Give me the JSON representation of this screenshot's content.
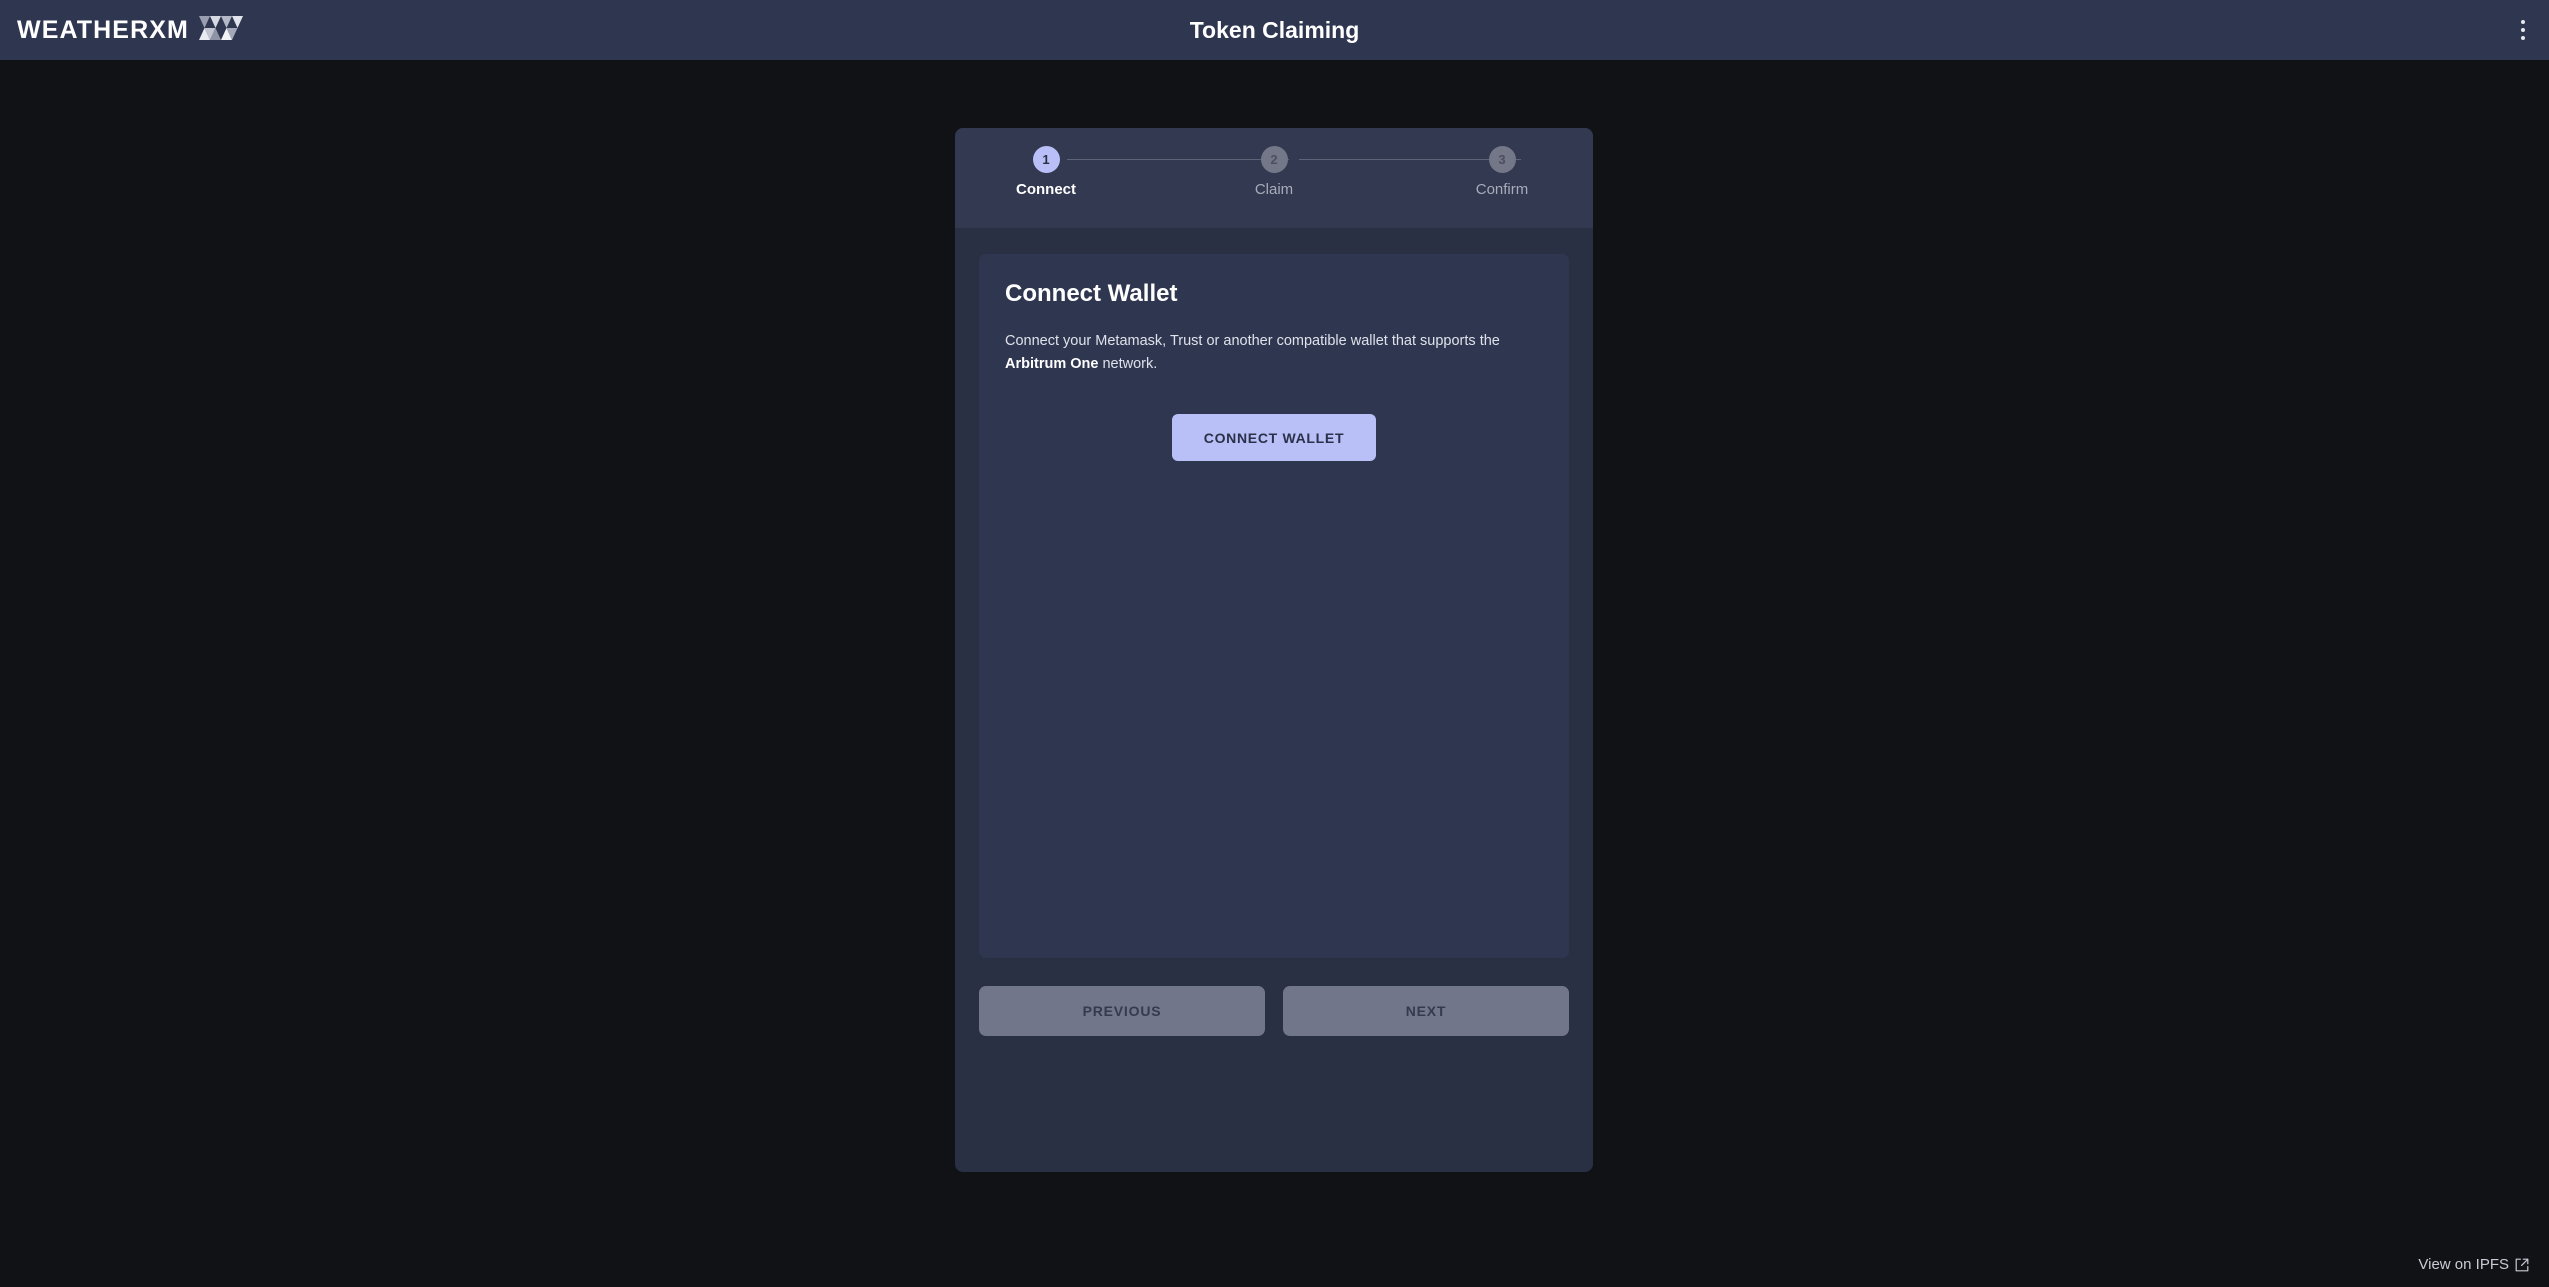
{
  "header": {
    "brand_word": "WEATHERXM",
    "brand_mark_icon": "weatherxm-logo-icon",
    "title": "Token Claiming",
    "menu_icon": "kebab-menu-icon"
  },
  "stepper": {
    "steps": [
      {
        "number": "1",
        "label": "Connect",
        "state": "active"
      },
      {
        "number": "2",
        "label": "Claim",
        "state": "inactive"
      },
      {
        "number": "3",
        "label": "Confirm",
        "state": "inactive"
      }
    ]
  },
  "card": {
    "title": "Connect Wallet",
    "body_before": "Connect your Metamask, Trust or another compatible wallet that supports the ",
    "body_bold": "Arbitrum One",
    "body_after": " network.",
    "connect_button": "CONNECT WALLET"
  },
  "nav": {
    "previous_label": "PREVIOUS",
    "next_label": "NEXT"
  },
  "footer": {
    "ipfs_label": "View on IPFS",
    "ipfs_icon": "external-link-icon"
  },
  "colors": {
    "page_background": "#101216",
    "appbar": "#2f3650",
    "wizard_background": "#2a3044",
    "stepper_background": "#323950",
    "card_background": "#2f3650",
    "accent": "#b9c0f7",
    "accent_text": "#2b3148",
    "disabled_button": "#72768a",
    "inactive_step": "#737787"
  }
}
